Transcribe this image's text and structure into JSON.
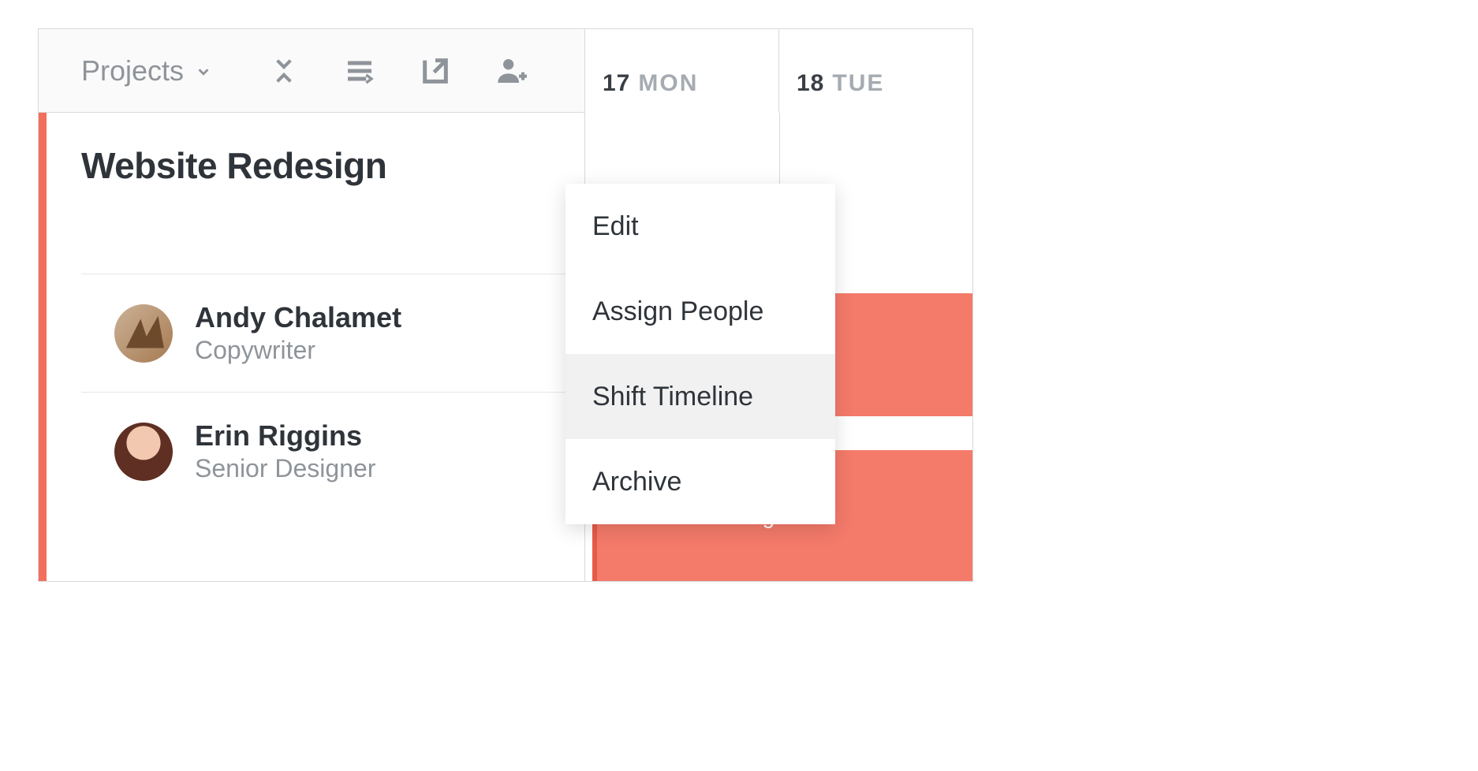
{
  "toolbar": {
    "dropdown_label": "Projects"
  },
  "date_columns": [
    {
      "num": "17",
      "day": "MON"
    },
    {
      "num": "18",
      "day": "TUE"
    }
  ],
  "project": {
    "title": "Website Redesign",
    "accent_color": "#f46e5c"
  },
  "people": [
    {
      "name": "Andy Chalamet",
      "role": "Copywriter"
    },
    {
      "name": "Erin Riggins",
      "role": "Senior Designer"
    }
  ],
  "tasks": [
    {
      "label": "Website Redesign"
    }
  ],
  "context_menu": {
    "items": [
      {
        "label": "Edit",
        "hovered": false
      },
      {
        "label": "Assign People",
        "hovered": false
      },
      {
        "label": "Shift Timeline",
        "hovered": true
      },
      {
        "label": "Archive",
        "hovered": false
      }
    ]
  }
}
